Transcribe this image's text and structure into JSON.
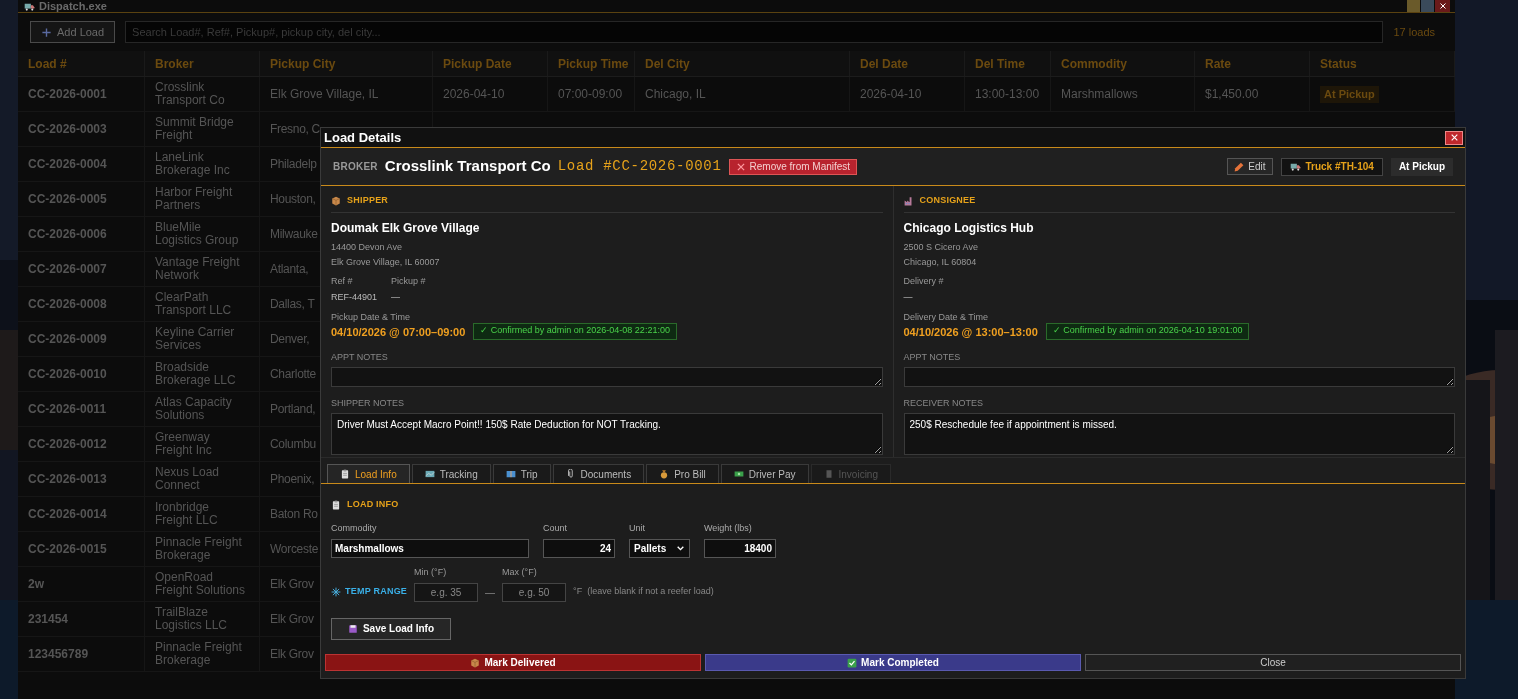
{
  "window": {
    "title": "Dispatch.exe"
  },
  "toolbar": {
    "add_button": "Add Load",
    "search_placeholder": "Search Load#, Ref#, Pickup#, pickup city, del city...",
    "count": "17 loads"
  },
  "table": {
    "columns": [
      "Load #",
      "Broker",
      "Pickup City",
      "Pickup Date",
      "Pickup Time",
      "Del City",
      "Del Date",
      "Del Time",
      "Commodity",
      "Rate",
      "Status"
    ],
    "rows": [
      {
        "cells": [
          "CC-2026-0001",
          "Crosslink Transport Co",
          "Elk Grove Village, IL",
          "2026-04-10",
          "07:00-09:00",
          "Chicago, IL",
          "2026-04-10",
          "13:00-13:00",
          "Marshmallows",
          "$1,450.00",
          "At Pickup"
        ]
      },
      {
        "cells": [
          "CC-2026-0003",
          "Summit Bridge Freight",
          "Fresno, C"
        ]
      },
      {
        "cells": [
          "CC-2026-0004",
          "LaneLink Brokerage Inc",
          "Philadelp"
        ]
      },
      {
        "cells": [
          "CC-2026-0005",
          "Harbor Freight Partners",
          "Houston,"
        ]
      },
      {
        "cells": [
          "CC-2026-0006",
          "BlueMile Logistics Group",
          "Milwauke"
        ]
      },
      {
        "cells": [
          "CC-2026-0007",
          "Vantage Freight Network",
          "Atlanta,"
        ]
      },
      {
        "cells": [
          "CC-2026-0008",
          "ClearPath Transport LLC",
          "Dallas, T"
        ]
      },
      {
        "cells": [
          "CC-2026-0009",
          "Keyline Carrier Services",
          "Denver,"
        ]
      },
      {
        "cells": [
          "CC-2026-0010",
          "Broadside Brokerage LLC",
          "Charlotte"
        ]
      },
      {
        "cells": [
          "CC-2026-0011",
          "Atlas Capacity Solutions",
          "Portland,"
        ]
      },
      {
        "cells": [
          "CC-2026-0012",
          "Greenway Freight Inc",
          "Columbu"
        ]
      },
      {
        "cells": [
          "CC-2026-0013",
          "Nexus Load Connect",
          "Phoenix,"
        ]
      },
      {
        "cells": [
          "CC-2026-0014",
          "Ironbridge Freight LLC",
          "Baton Ro"
        ]
      },
      {
        "cells": [
          "CC-2026-0015",
          "Pinnacle Freight Brokerage",
          "Worceste"
        ]
      },
      {
        "cells": [
          "2w",
          "OpenRoad Freight Solutions",
          "Elk Grov"
        ]
      },
      {
        "cells": [
          "231454",
          "TrailBlaze Logistics LLC",
          "Elk Grov"
        ]
      },
      {
        "cells": [
          "123456789",
          "Pinnacle Freight Brokerage",
          "Elk Grov"
        ]
      }
    ]
  },
  "modal": {
    "title": "Load Details",
    "broker_label": "BROKER",
    "broker": "Crosslink Transport Co",
    "load_number": "Load #CC-2026-0001",
    "remove_button": "Remove from Manifest",
    "edit_button": "Edit",
    "truck_button": "Truck #TH-104",
    "status": "At Pickup",
    "parties": [
      {
        "kind": "shipper",
        "heading": "SHIPPER",
        "name": "Doumak Elk Grove Village",
        "address_lines": [
          "14400 Devon Ave",
          "Elk Grove Village, IL 60007"
        ],
        "fields": [
          {
            "label": "Ref #",
            "value": "REF-44901"
          },
          {
            "label": "Pickup #",
            "value": "—"
          }
        ],
        "datetime_label": "Pickup Date & Time",
        "datetime": "04/10/2026 @ 07:00–09:00",
        "confirmation": "✓ Confirmed by admin on 2026-04-08 22:21:00",
        "appt_label": "APPT NOTES",
        "notes_label": "SHIPPER NOTES",
        "notes": "Driver Must Accept Macro Point!! 150$ Rate Deduction for NOT Tracking."
      },
      {
        "kind": "consignee",
        "heading": "CONSIGNEE",
        "name": "Chicago Logistics Hub",
        "address_lines": [
          "2500 S Cicero Ave",
          "Chicago, IL 60804"
        ],
        "fields": [
          {
            "label": "Delivery #",
            "value": "—"
          }
        ],
        "datetime_label": "Delivery Date & Time",
        "datetime": "04/10/2026 @ 13:00–13:00",
        "confirmation": "✓ Confirmed by admin on 2026-04-10 19:01:00",
        "appt_label": "APPT NOTES",
        "notes_label": "RECEIVER NOTES",
        "notes": "250$ Reschedule fee if appointment is missed."
      }
    ],
    "tabs": [
      {
        "label": "Load Info",
        "selected": true,
        "disabled": false
      },
      {
        "label": "Tracking",
        "selected": false,
        "disabled": false
      },
      {
        "label": "Trip",
        "selected": false,
        "disabled": false
      },
      {
        "label": "Documents",
        "selected": false,
        "disabled": false
      },
      {
        "label": "Pro Bill",
        "selected": false,
        "disabled": false
      },
      {
        "label": "Driver Pay",
        "selected": false,
        "disabled": false
      },
      {
        "label": "Invoicing",
        "selected": false,
        "disabled": true
      }
    ],
    "load_info": {
      "heading": "LOAD INFO",
      "fields": [
        {
          "kind": "text",
          "label": "Commodity",
          "value": "Marshmallows"
        },
        {
          "kind": "number",
          "label": "Count",
          "value": "24"
        },
        {
          "kind": "select",
          "label": "Unit",
          "value": "Pallets"
        },
        {
          "kind": "number",
          "label": "Weight (lbs)",
          "value": "18400"
        }
      ],
      "temp": {
        "heading": "TEMP RANGE",
        "min_label": "Min (°F)",
        "min_placeholder": "e.g. 35",
        "separator": "—",
        "max_label": "Max (°F)",
        "max_placeholder": "e.g. 50",
        "note": "°F  (leave blank if not a reefer load)"
      },
      "save_button": "Save Load Info"
    },
    "footer_buttons": [
      {
        "kind": "delivered",
        "label": "Mark Delivered"
      },
      {
        "kind": "completed",
        "label": "Mark Completed"
      },
      {
        "kind": "close",
        "label": "Close"
      }
    ]
  }
}
